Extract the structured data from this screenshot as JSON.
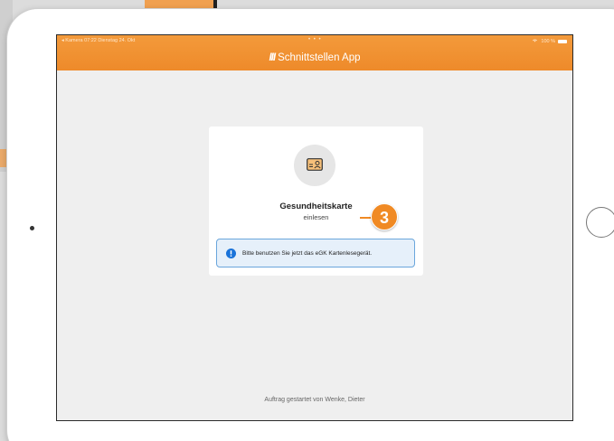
{
  "status_bar": {
    "left": "◂ Kamera  07:22  Dienstag 24. Okt",
    "center": "• • •",
    "right": "100 %"
  },
  "header": {
    "logo_mark": "III",
    "title": "Schnittstellen App"
  },
  "card": {
    "icon": "id-card-icon",
    "title": "Gesundheitskarte",
    "subtitle": "einlesen",
    "info_message": "Bitte benutzen Sie jetzt das eGK Kartenlesegerät."
  },
  "callout": {
    "number": "3"
  },
  "footer": {
    "text": "Auftrag gestartet von Wenke, Dieter"
  },
  "colors": {
    "accent": "#f08a24",
    "info_border": "#6aa6dc",
    "info_bg": "#e6f0fa",
    "info_icon": "#1a73d9"
  }
}
